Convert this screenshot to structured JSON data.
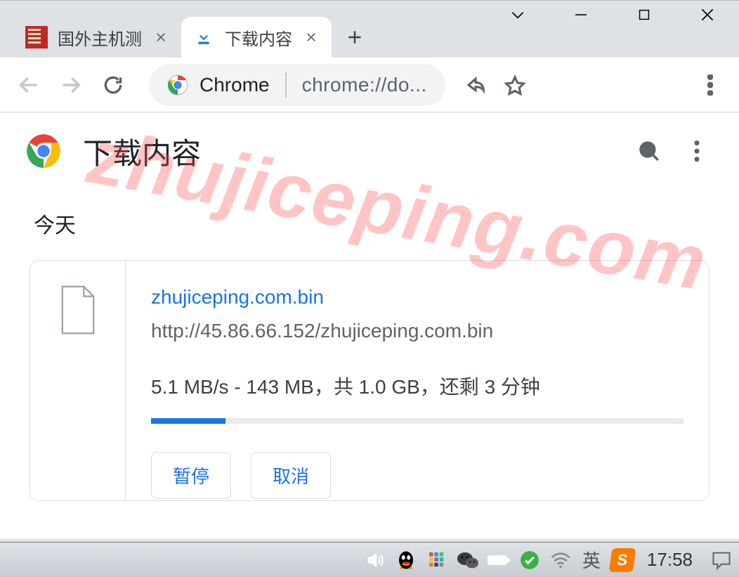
{
  "tabs": [
    {
      "title": "国外主机测",
      "active": false
    },
    {
      "title": "下载内容",
      "active": true
    }
  ],
  "omnibox": {
    "label": "Chrome",
    "url": "chrome://do..."
  },
  "page": {
    "title": "下载内容",
    "section_today": "今天"
  },
  "download": {
    "filename": "zhujiceping.com.bin",
    "url": "http://45.86.66.152/zhujiceping.com.bin",
    "status": "5.1 MB/s - 143 MB，共 1.0 GB，还剩 3 分钟",
    "progress_percent": 14,
    "actions": {
      "pause": "暂停",
      "cancel": "取消"
    }
  },
  "taskbar": {
    "ime": "英",
    "clock": "17:58"
  },
  "watermark": "zhujiceping.com"
}
